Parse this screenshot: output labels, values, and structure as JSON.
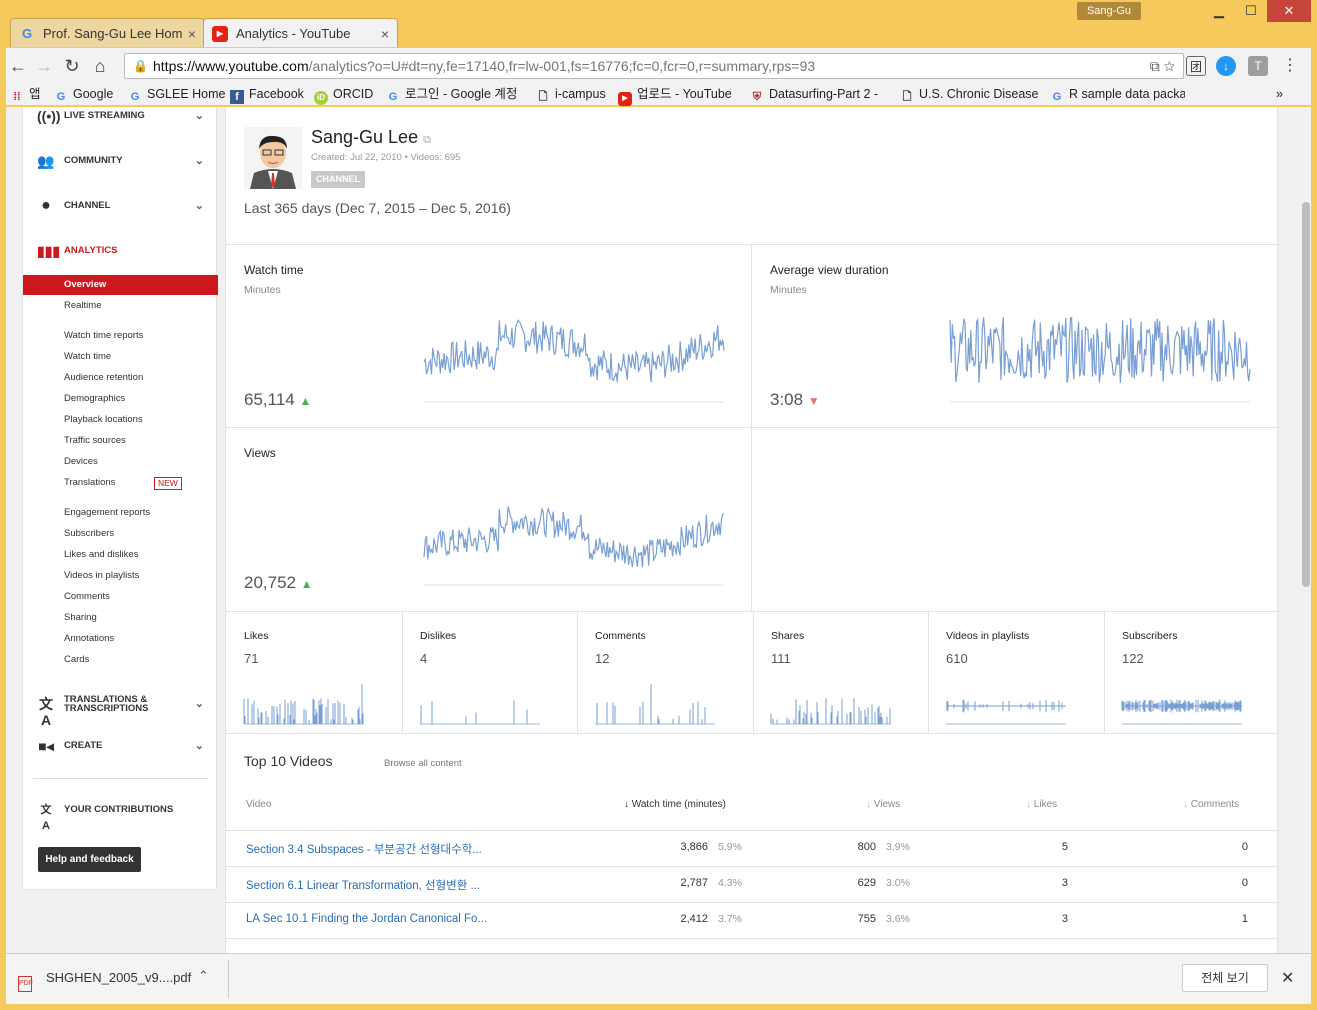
{
  "browser": {
    "user_badge": "Sang-Gu",
    "tabs": [
      {
        "label": "Prof. Sang-Gu Lee Home",
        "close": "×"
      },
      {
        "label": "Analytics - YouTube",
        "close": "×"
      }
    ],
    "url_host": "https://www.youtube.com",
    "url_path": "/analytics?o=U#dt=ny,fe=17140,fr=lw-001,fs=16776;fc=0,fcr=0,r=summary,rps=93",
    "bookmarks": [
      {
        "label": "앱",
        "icon": "apps-grid-icon"
      },
      {
        "label": "Google",
        "icon": "google-icon"
      },
      {
        "label": "SGLEE Home",
        "icon": "google-icon"
      },
      {
        "label": "Facebook",
        "icon": "facebook-icon"
      },
      {
        "label": "ORCID",
        "icon": "orcid-icon"
      },
      {
        "label": "로그인 - Google 계정",
        "icon": "google-icon"
      },
      {
        "label": "i-campus",
        "icon": "page-icon"
      },
      {
        "label": "업로드 - YouTube",
        "icon": "youtube-icon"
      },
      {
        "label": "Datasurfing-Part 2 -",
        "icon": "shield-icon"
      },
      {
        "label": "U.S. Chronic Disease",
        "icon": "page-icon"
      },
      {
        "label": "R sample data packa",
        "icon": "google-icon"
      }
    ],
    "bookmarks_more": "»"
  },
  "sidebar": {
    "sections": [
      {
        "label": "LIVE STREAMING",
        "icon": "live-streaming-icon"
      },
      {
        "label": "COMMUNITY",
        "icon": "community-icon"
      },
      {
        "label": "CHANNEL",
        "icon": "channel-icon"
      },
      {
        "label": "ANALYTICS",
        "icon": "analytics-icon"
      }
    ],
    "analytics_items": [
      "Overview",
      "Realtime"
    ],
    "watch_items": [
      "Watch time reports",
      "Watch time",
      "Audience retention",
      "Demographics",
      "Playback locations",
      "Traffic sources",
      "Devices",
      "Translations"
    ],
    "new_badge": "NEW",
    "engagement_items": [
      "Engagement reports",
      "Subscribers",
      "Likes and dislikes",
      "Videos in playlists",
      "Comments",
      "Sharing",
      "Annotations",
      "Cards"
    ],
    "translations_line1": "TRANSLATIONS &",
    "translations_line2": "TRANSCRIPTIONS",
    "create": "CREATE",
    "contributions": "YOUR CONTRIBUTIONS",
    "help": "Help and feedback"
  },
  "channel": {
    "name": "Sang-Gu Lee",
    "created": "Created: Jul 22, 2010",
    "videos": "Videos: 695",
    "badge": "CHANNEL",
    "period": "Last 365 days (Dec 7, 2015 – Dec 5, 2016)"
  },
  "metrics": {
    "watch_time": {
      "title": "Watch time",
      "unit": "Minutes",
      "value": "65,114",
      "trend": "▲"
    },
    "avg_duration": {
      "title": "Average view duration",
      "unit": "Minutes",
      "value": "3:08",
      "trend": "▼"
    },
    "views": {
      "title": "Views",
      "value": "20,752",
      "trend": "▲"
    }
  },
  "small_metrics": [
    {
      "title": "Likes",
      "value": "71"
    },
    {
      "title": "Dislikes",
      "value": "4"
    },
    {
      "title": "Comments",
      "value": "12"
    },
    {
      "title": "Shares",
      "value": "111"
    },
    {
      "title": "Videos in playlists",
      "value": "610"
    },
    {
      "title": "Subscribers",
      "value": "122"
    }
  ],
  "top10": {
    "title": "Top 10 Videos",
    "browse": "Browse all content",
    "headers": {
      "video": "Video",
      "watch": "Watch time (minutes)",
      "views": "Views",
      "likes": "Likes",
      "comments": "Comments"
    },
    "rows": [
      {
        "name": "Section 3.4 Subspaces - 부분공간 선형대수학...",
        "watch": "3,866",
        "watch_pct": "5.9%",
        "views": "800",
        "views_pct": "3.9%",
        "likes": "5",
        "comments": "0"
      },
      {
        "name": "Section 6.1 Linear Transformation, 선형변환 ...",
        "watch": "2,787",
        "watch_pct": "4.3%",
        "views": "629",
        "views_pct": "3.0%",
        "likes": "3",
        "comments": "0"
      },
      {
        "name": "LA Sec 10.1 Finding the Jordan Canonical Fo...",
        "watch": "2,412",
        "watch_pct": "3.7%",
        "views": "755",
        "views_pct": "3.6%",
        "likes": "3",
        "comments": "1"
      }
    ]
  },
  "downloads": {
    "file": "SHGHEN_2005_v9....pdf",
    "show_all": "전체 보기"
  },
  "colors": {
    "accent": "#cc181e",
    "spark": "#7a9fd4",
    "link": "#2a6cb8"
  }
}
